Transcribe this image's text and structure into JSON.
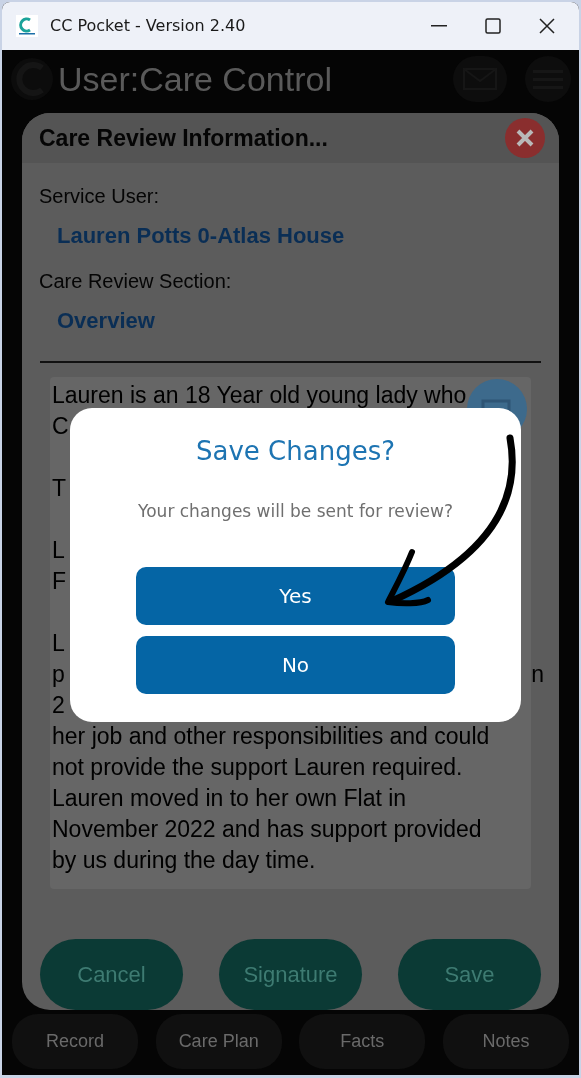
{
  "window": {
    "title": "CC Pocket - Version 2.40"
  },
  "app_header": {
    "title": "User:Care Control"
  },
  "care_review": {
    "title": "Care Review Information...",
    "fields": [
      {
        "label": "Service User:",
        "value": "Lauren Potts 0-Atlas House"
      },
      {
        "label": "Care Review Section:",
        "value": "Overview"
      }
    ],
    "note_lines": [
      {
        "kind": "line",
        "text": "Lauren is an 18 Year old young lady who"
      },
      {
        "kind": "line",
        "text": "C"
      },
      {
        "kind": "gap"
      },
      {
        "kind": "line",
        "text": "T"
      },
      {
        "kind": "gap"
      },
      {
        "kind": "line",
        "text": "L"
      },
      {
        "kind": "line",
        "text": "F"
      },
      {
        "kind": "gap"
      },
      {
        "kind": "line",
        "text": "L"
      },
      {
        "kind": "split",
        "text": "p",
        "end": "n"
      },
      {
        "kind": "line",
        "text": "2"
      },
      {
        "kind": "line",
        "text": "her job and other responsibilities and could"
      },
      {
        "kind": "line",
        "text": "not provide the support Lauren required."
      },
      {
        "kind": "line",
        "text": "Lauren moved in to her own Flat in"
      },
      {
        "kind": "line",
        "text": "November 2022 and has support provided"
      },
      {
        "kind": "line",
        "text": "by us during the day time."
      }
    ],
    "buttons": [
      "Cancel",
      "Signature",
      "Save"
    ]
  },
  "bottom_tabs": [
    "Record",
    "Care Plan",
    "Facts",
    "Notes"
  ],
  "dialog": {
    "title": "Save Changes?",
    "message": "Your changes will be sent for review?",
    "buttons": [
      "Yes",
      "No"
    ]
  }
}
